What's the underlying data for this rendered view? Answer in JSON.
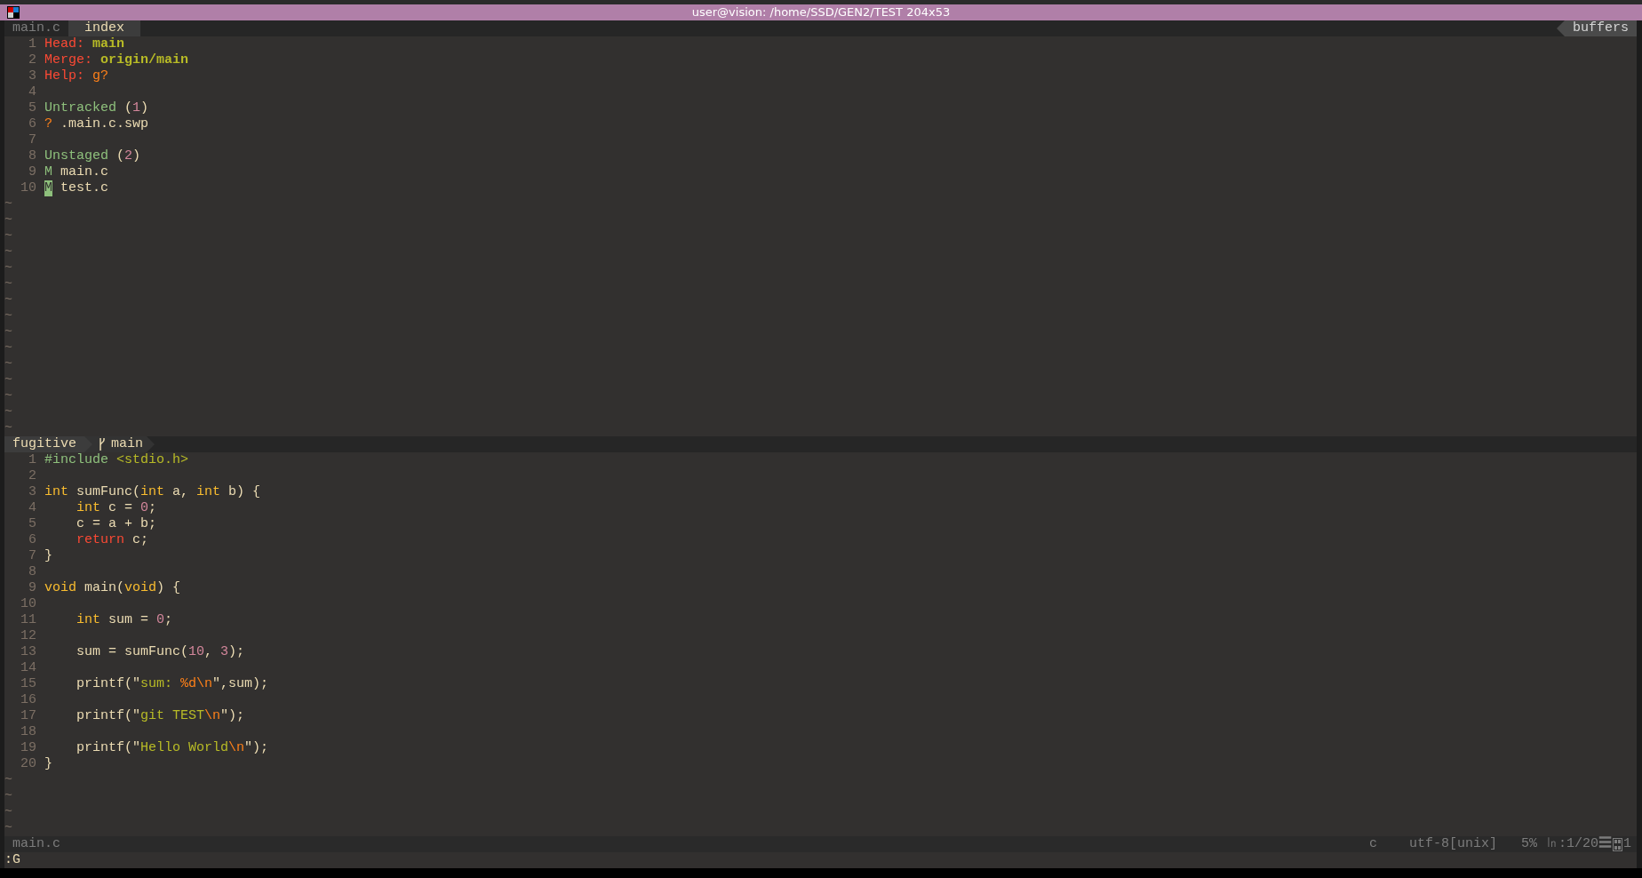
{
  "window": {
    "title": "user@vision: /home/SSD/GEN2/TEST 204x53"
  },
  "tabline": {
    "tabs": [
      {
        "label": "main.c",
        "selected": false
      },
      {
        "label": "index",
        "selected": true
      }
    ],
    "buffers_label": "buffers"
  },
  "top_pane": {
    "lines": [
      {
        "number": "1",
        "tokens": [
          {
            "text": "Head: ",
            "kind": "label"
          },
          {
            "text": "main",
            "kind": "ref"
          }
        ]
      },
      {
        "number": "2",
        "tokens": [
          {
            "text": "Merge: ",
            "kind": "label"
          },
          {
            "text": "origin/main",
            "kind": "ref"
          }
        ]
      },
      {
        "number": "3",
        "tokens": [
          {
            "text": "Help: ",
            "kind": "label"
          },
          {
            "text": "g?",
            "kind": "key"
          }
        ]
      },
      {
        "number": "4"
      },
      {
        "number": "5",
        "tokens": [
          {
            "text": "Untracked ",
            "kind": "section"
          },
          {
            "text": "(",
            "kind": "plain"
          },
          {
            "text": "1",
            "kind": "count"
          },
          {
            "text": ")",
            "kind": "plain"
          }
        ]
      },
      {
        "number": "6",
        "tokens": [
          {
            "text": "?",
            "kind": "status"
          },
          {
            "text": " .main.c.swp",
            "kind": "plain"
          }
        ]
      },
      {
        "number": "7"
      },
      {
        "number": "8",
        "tokens": [
          {
            "text": "Unstaged ",
            "kind": "section"
          },
          {
            "text": "(",
            "kind": "plain"
          },
          {
            "text": "2",
            "kind": "count"
          },
          {
            "text": ")",
            "kind": "plain"
          }
        ]
      },
      {
        "number": "9",
        "tokens": [
          {
            "text": "M",
            "kind": "section"
          },
          {
            "text": " main.c",
            "kind": "plain"
          }
        ]
      },
      {
        "number": "10",
        "tokens": [
          {
            "text": "M",
            "kind": "cursor"
          },
          {
            "text": " test.c",
            "kind": "plain"
          }
        ]
      }
    ],
    "filler": [
      "~",
      "~",
      "~",
      "~",
      "~",
      "~",
      "~",
      "~",
      "~",
      "~",
      "~",
      "~",
      "~",
      "~",
      "~"
    ]
  },
  "top_statusline": {
    "mode": "fugitive",
    "branch": "main"
  },
  "bottom_pane": {
    "lines": [
      {
        "number": "1",
        "tokens": [
          {
            "text": "#include",
            "kind": "preproc"
          },
          {
            "text": " <stdio.h>",
            "kind": "header"
          }
        ]
      },
      {
        "number": "2"
      },
      {
        "number": "3",
        "tokens": [
          {
            "text": "int",
            "kind": "type"
          },
          {
            "text": " sumFunc(",
            "kind": "plain"
          },
          {
            "text": "int",
            "kind": "type"
          },
          {
            "text": " a, ",
            "kind": "plain"
          },
          {
            "text": "int",
            "kind": "type"
          },
          {
            "text": " b) {",
            "kind": "plain"
          }
        ]
      },
      {
        "number": "4",
        "tokens": [
          {
            "text": "    int",
            "kind": "type"
          },
          {
            "text": " c = ",
            "kind": "plain"
          },
          {
            "text": "0",
            "kind": "number"
          },
          {
            "text": ";",
            "kind": "plain"
          }
        ]
      },
      {
        "number": "5",
        "tokens": [
          {
            "text": "    c = a + b;",
            "kind": "plain"
          }
        ]
      },
      {
        "number": "6",
        "tokens": [
          {
            "text": "    return",
            "kind": "keyword"
          },
          {
            "text": " c;",
            "kind": "plain"
          }
        ]
      },
      {
        "number": "7",
        "tokens": [
          {
            "text": "}",
            "kind": "plain"
          }
        ]
      },
      {
        "number": "8"
      },
      {
        "number": "9",
        "tokens": [
          {
            "text": "void",
            "kind": "type"
          },
          {
            "text": " main(",
            "kind": "plain"
          },
          {
            "text": "void",
            "kind": "type"
          },
          {
            "text": ") {",
            "kind": "plain"
          }
        ]
      },
      {
        "number": "10"
      },
      {
        "number": "11",
        "tokens": [
          {
            "text": "    int",
            "kind": "type"
          },
          {
            "text": " sum = ",
            "kind": "plain"
          },
          {
            "text": "0",
            "kind": "number"
          },
          {
            "text": ";",
            "kind": "plain"
          }
        ]
      },
      {
        "number": "12"
      },
      {
        "number": "13",
        "tokens": [
          {
            "text": "    sum = sumFunc(",
            "kind": "plain"
          },
          {
            "text": "10",
            "kind": "number"
          },
          {
            "text": ", ",
            "kind": "plain"
          },
          {
            "text": "3",
            "kind": "number"
          },
          {
            "text": ");",
            "kind": "plain"
          }
        ]
      },
      {
        "number": "14"
      },
      {
        "number": "15",
        "tokens": [
          {
            "text": "    printf(\"",
            "kind": "plain"
          },
          {
            "text": "sum: ",
            "kind": "string"
          },
          {
            "text": "%d\\n",
            "kind": "escape"
          },
          {
            "text": "\",sum);",
            "kind": "plain"
          }
        ]
      },
      {
        "number": "16"
      },
      {
        "number": "17",
        "tokens": [
          {
            "text": "    printf(\"",
            "kind": "plain"
          },
          {
            "text": "git TEST",
            "kind": "string"
          },
          {
            "text": "\\n",
            "kind": "escape"
          },
          {
            "text": "\");",
            "kind": "plain"
          }
        ]
      },
      {
        "number": "18"
      },
      {
        "number": "19",
        "tokens": [
          {
            "text": "    printf(\"",
            "kind": "plain"
          },
          {
            "text": "Hello World",
            "kind": "string"
          },
          {
            "text": "\\n",
            "kind": "escape"
          },
          {
            "text": "\");",
            "kind": "plain"
          }
        ]
      },
      {
        "number": "20",
        "tokens": [
          {
            "text": "}",
            "kind": "plain"
          }
        ]
      }
    ],
    "filler": [
      "~",
      "~",
      "~",
      "~"
    ]
  },
  "bottom_statusline": {
    "file": "main.c",
    "filetype": "c",
    "encoding": "utf-8[unix]",
    "percent": "5%",
    "position": "㏑:1/20☰",
    "column": "1"
  },
  "command_line": ":G"
}
